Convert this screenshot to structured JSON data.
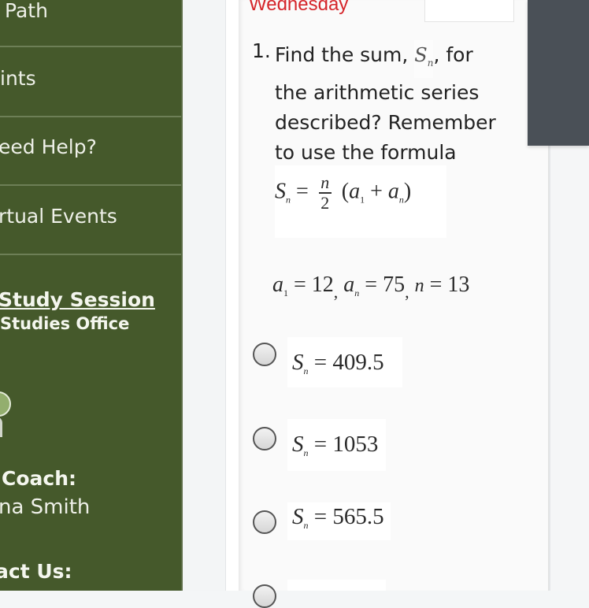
{
  "sidebar": {
    "nav_items": [
      {
        "label": "Path"
      },
      {
        "label": "ints"
      },
      {
        "label": "eed Help?"
      },
      {
        "label": "rtual Events"
      }
    ],
    "study_session": {
      "link": "Study Session",
      "subtitle": "Studies Office"
    },
    "coach": {
      "label": "Coach:",
      "name": "na Smith"
    },
    "contact": {
      "label": "act Us:"
    },
    "colors": {
      "background": "#45592b",
      "divider": "#6d7f56"
    }
  },
  "header": {
    "day": "Wednesday",
    "day_color": "#d5262b"
  },
  "question": {
    "number": "1.",
    "text_lines": [
      "Find the sum,",
      ", for",
      "the arithmetic series",
      "described? Remember",
      "to use the formula"
    ],
    "symbol": "S",
    "symbol_sub": "n",
    "formula": {
      "lhs": "S",
      "lhs_sub": "n",
      "eq": "=",
      "frac_num": "n",
      "frac_den": "2",
      "paren_open": "(",
      "a": "a",
      "a1_sub": "1",
      "plus": "+",
      "an_sub": "n",
      "paren_close": ")"
    },
    "given": {
      "a1_label": "a",
      "a1_sub": "1",
      "a1_value": "= 12",
      "sep1": ",",
      "an_label": "a",
      "an_sub": "n",
      "an_value": "= 75",
      "sep2": ",",
      "n_label": "n",
      "n_value": "= 13"
    },
    "choices": [
      {
        "lhs": "S",
        "sub": "n",
        "rhs": "= 409.5"
      },
      {
        "lhs": "S",
        "sub": "n",
        "rhs": "= 1053"
      },
      {
        "lhs": "S",
        "sub": "n",
        "rhs": "= 565.5"
      }
    ]
  }
}
